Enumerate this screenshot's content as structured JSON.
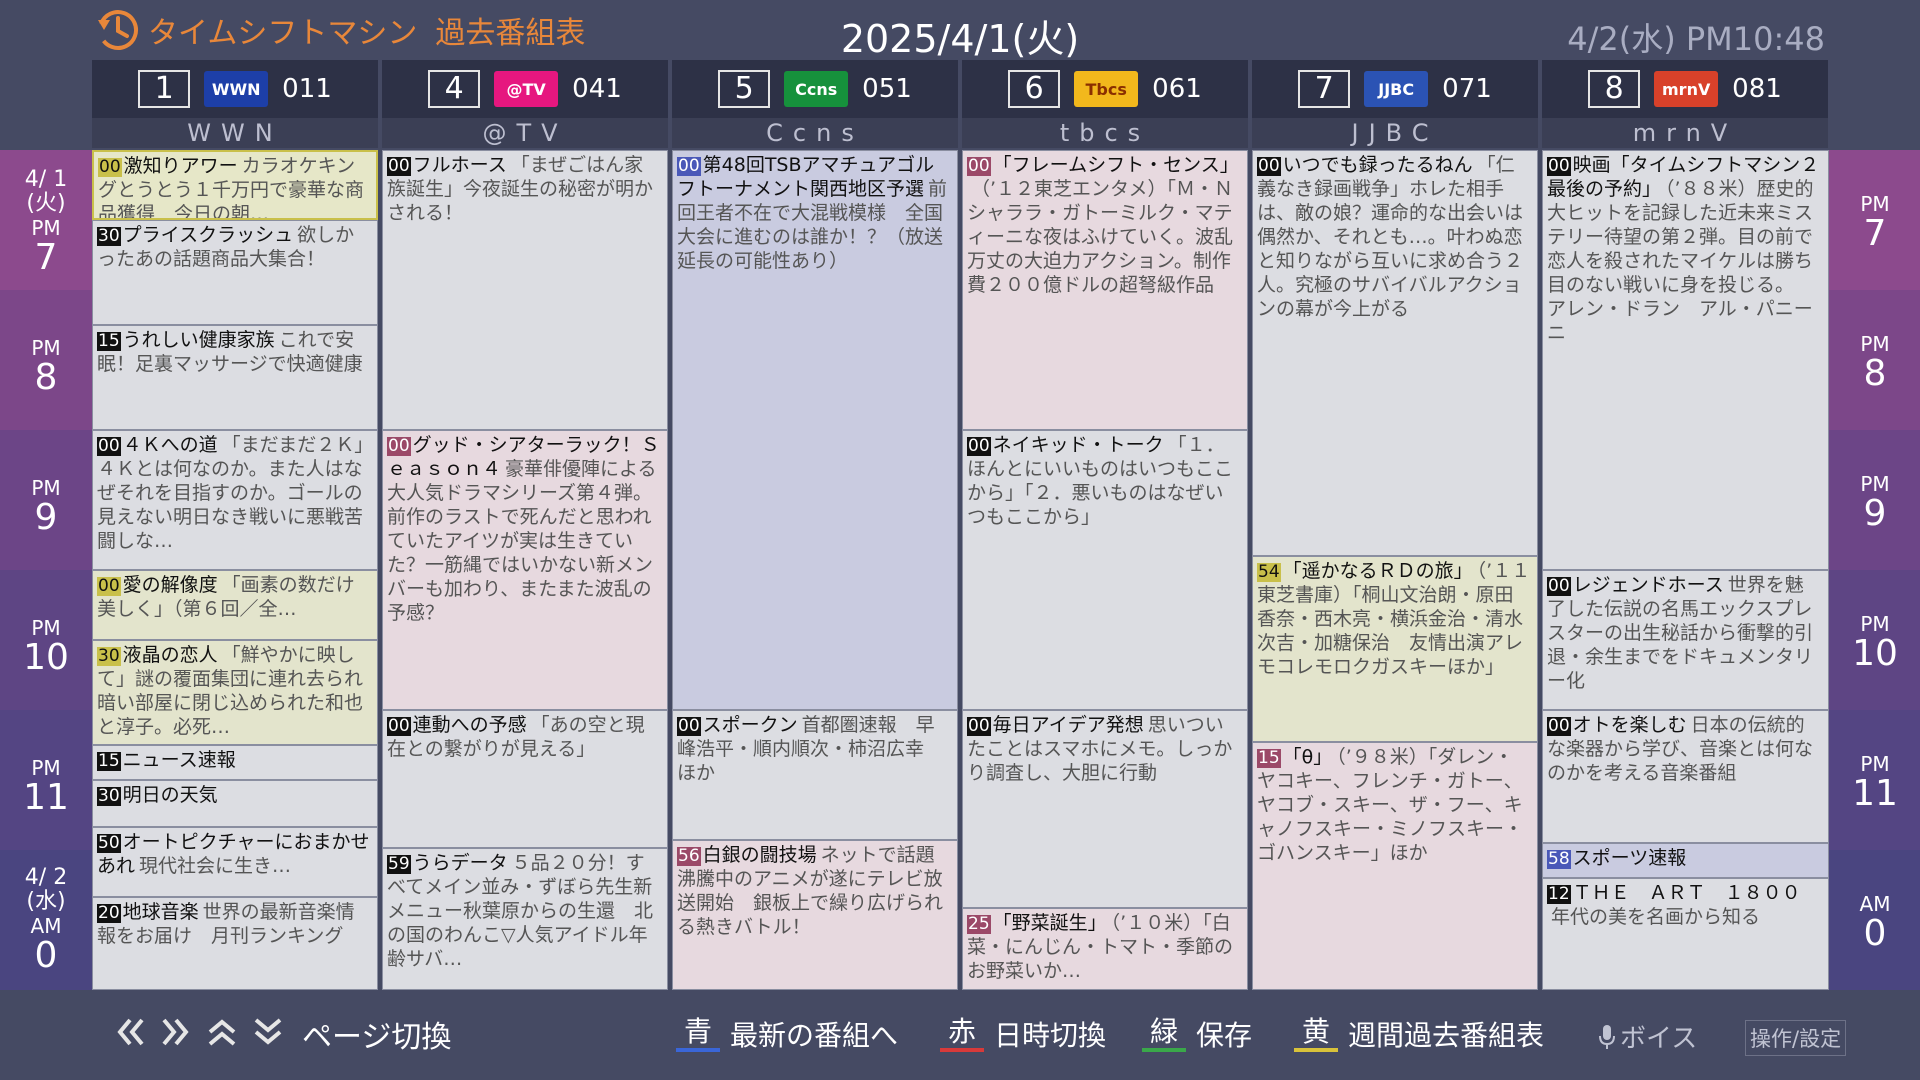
{
  "header": {
    "app_title": "タイムシフトマシン",
    "section_title": "過去番組表",
    "date": "2025/4/1(火)",
    "current_time": "4/2(水) PM10:48"
  },
  "channels": [
    {
      "num": "1",
      "logo": "WWN",
      "code": "011",
      "name": "WWN",
      "logo_bg": "#1d3fa8",
      "logo_fg": "#ffffff"
    },
    {
      "num": "4",
      "logo": "@TV",
      "code": "041",
      "name": "@TV",
      "logo_bg": "#e6177f",
      "logo_fg": "#ffffff"
    },
    {
      "num": "5",
      "logo": "Ccns",
      "code": "051",
      "name": "Ccns",
      "logo_bg": "#16913c",
      "logo_fg": "#ffffff"
    },
    {
      "num": "6",
      "logo": "Tbcs",
      "code": "061",
      "name": "tbcs",
      "logo_bg": "#f2b81c",
      "logo_fg": "#8a2f00"
    },
    {
      "num": "7",
      "logo": "JJBC",
      "code": "071",
      "name": "JJBC",
      "logo_bg": "#2b53b4",
      "logo_fg": "#ffffff"
    },
    {
      "num": "8",
      "logo": "mrnV",
      "code": "081",
      "name": "mrnV",
      "logo_bg": "#d8412a",
      "logo_fg": "#ffffff"
    }
  ],
  "timeline": {
    "day1": {
      "date": "4/ 1",
      "weekday": "(火)"
    },
    "day2": {
      "date": "4/ 2",
      "weekday": "(水)"
    },
    "hours": [
      {
        "period": "PM",
        "hour": "7"
      },
      {
        "period": "PM",
        "hour": "8"
      },
      {
        "period": "PM",
        "hour": "9"
      },
      {
        "period": "PM",
        "hour": "10"
      },
      {
        "period": "PM",
        "hour": "11"
      },
      {
        "period": "AM",
        "hour": "0"
      }
    ]
  },
  "programs": {
    "ch1": [
      {
        "min": "00",
        "title": "激知りアワー",
        "desc": "カラオケキングとうとう１千万円で豪華な商品獲得　今日の朝…"
      },
      {
        "min": "30",
        "title": "プライスクラッシュ",
        "desc": "欲しかったあの話題商品大集合！"
      },
      {
        "min": "15",
        "title": "うれしい健康家族",
        "desc": "これで安眠！足裏マッサージで快適健康"
      },
      {
        "min": "00",
        "title": "４Ｋへの道",
        "desc": "「まだまだ２Ｋ」４Ｋとは何なのか。また人はなぜそれを目指すのか。ゴールの見えない明日なき戦いに悪戦苦闘しな…"
      },
      {
        "min": "00",
        "title": "愛の解像度",
        "desc": "「画素の数だけ美しく」（第６回／全…"
      },
      {
        "min": "30",
        "title": "液晶の恋人",
        "desc": "「鮮やかに映して」謎の覆面集団に連れ去られ暗い部屋に閉じ込められた和也と淳子。必死…"
      },
      {
        "min": "15",
        "title": "ニュース速報",
        "desc": ""
      },
      {
        "min": "30",
        "title": "明日の天気",
        "desc": ""
      },
      {
        "min": "50",
        "title": "オートピクチャーにおまかせあれ",
        "desc": "現代社会に生き…"
      },
      {
        "min": "20",
        "title": "地球音楽",
        "desc": "世界の最新音楽情報をお届け　月刊ランキング"
      }
    ],
    "ch4": [
      {
        "min": "00",
        "title": "フルホース",
        "desc": "「まぜごはん家族誕生」今夜誕生の秘密が明かされる！"
      },
      {
        "min": "00",
        "title": "グッド・シアターラック！Ｓｅａｓｏｎ４",
        "desc": "豪華俳優陣による大人気ドラマシリーズ第４弾。前作のラストで死んだと思われていたアイツが実は生きていた？一筋縄ではいかない新メンバーも加わり、またまた波乱の予感？"
      },
      {
        "min": "00",
        "title": "連動への予感",
        "desc": "「あの空と現在との繋がりが見える」"
      },
      {
        "min": "59",
        "title": "うらデータ",
        "desc": "５品２０分！すべてメイン並み・ずぼら先生新メニュー秋葉原からの生還　北の国のわんこ▽人気アイドル年齢サバ…"
      }
    ],
    "ch5": [
      {
        "min": "00",
        "title": "第48回TSBアマチュアゴルフトーナメント関西地区予選",
        "desc": "前回王者不在で大混戦模様　全国大会に進むのは誰か！？（放送延長の可能性あり）"
      },
      {
        "min": "00",
        "title": "スポークン",
        "desc": "首都圏速報　早峰浩平・順内順次・柿沼広幸　ほか"
      },
      {
        "min": "56",
        "title": "白銀の闘技場",
        "desc": "ネットで話題沸騰中のアニメが遂にテレビ放送開始　銀板上で繰り広げられる熱きバトル！"
      }
    ],
    "ch6": [
      {
        "min": "00",
        "title": "「フレームシフト・センス」",
        "desc": "（’１２東芝エンタメ）「Ｍ・Ｎシャララ・ガトーミルク・マティーニな夜はふけていく。波乱万丈の大迫力アクション。制作費２００億ドルの超弩級作品"
      },
      {
        "min": "00",
        "title": "ネイキッド・トーク",
        "desc": "「１．ほんとにいいものはいつもここから」「２．悪いものはなぜいつもここから」"
      },
      {
        "min": "00",
        "title": "毎日アイデア発想",
        "desc": "思いついたことはスマホにメモ。しっかり調査し、大胆に行動"
      },
      {
        "min": "25",
        "title": "「野菜誕生」",
        "desc": "（’１０米）「白菜・にんじん・トマト・季節のお野菜いか…"
      }
    ],
    "ch7": [
      {
        "min": "00",
        "title": "いつでも録ったるねん",
        "desc": "「仁義なき録画戦争」ホレた相手は、敵の娘？運命的な出会いは偶然か、それとも…。叶わぬ恋と知りながら互いに求め合う２人。究極のサバイバルアクションの幕が今上がる"
      },
      {
        "min": "54",
        "title": "「遥かなるＲＤの旅」",
        "desc": "（’１１東芝書庫）「桐山文治朗・原田香奈・西木亮・横浜金治・清水次吉・加糖保治　友情出演アレモコレモロクガスキーほか」"
      },
      {
        "min": "15",
        "title": "「θ」",
        "desc": "（’９８米）「ダレン・ヤコキー、フレンチ・ガトー、ヤコブ・スキー、ザ・フー、キャノフスキー・ミノフスキー・ゴハンスキー」ほか"
      }
    ],
    "ch8": [
      {
        "min": "00",
        "title": "映画「タイムシフトマシン２　最後の予約」",
        "desc": "（’８８米）歴史的大ヒットを記録した近未来ミステリー待望の第２弾。目の前で恋人を殺されたマイケルは勝ち目のない戦いに身を投じる。　アレン・ドラン　アル・パニーニ"
      },
      {
        "min": "00",
        "title": "レジェンドホース",
        "desc": "世界を魅了した伝説の名馬エックスプレスターの出生秘話から衝撃的引退・余生までをドキュメンタリー化"
      },
      {
        "min": "00",
        "title": "オトを楽しむ",
        "desc": "日本の伝統的な楽器から学び、音楽とは何なのかを考える音楽番組"
      },
      {
        "min": "58",
        "title": "スポーツ速報",
        "desc": ""
      },
      {
        "min": "12",
        "title": "ＴＨＥ　ＡＲＴ　１８００",
        "desc": "年代の美を名画から知る"
      }
    ]
  },
  "footer": {
    "page_switch": "ページ切換",
    "blue_key": "青",
    "blue_label": "最新の番組へ",
    "red_key": "赤",
    "red_label": "日時切換",
    "green_key": "緑",
    "green_label": "保存",
    "yellow_key": "黄",
    "yellow_label": "週間過去番組表",
    "voice": "ボイス",
    "settings": "操作/設定"
  },
  "colors": {
    "accent_orange": "#e8873a",
    "blue": "#3a66d8",
    "red": "#d83a3a",
    "green": "#3aa84a",
    "yellow": "#d8c23a",
    "highlight": "#c9c04a"
  }
}
